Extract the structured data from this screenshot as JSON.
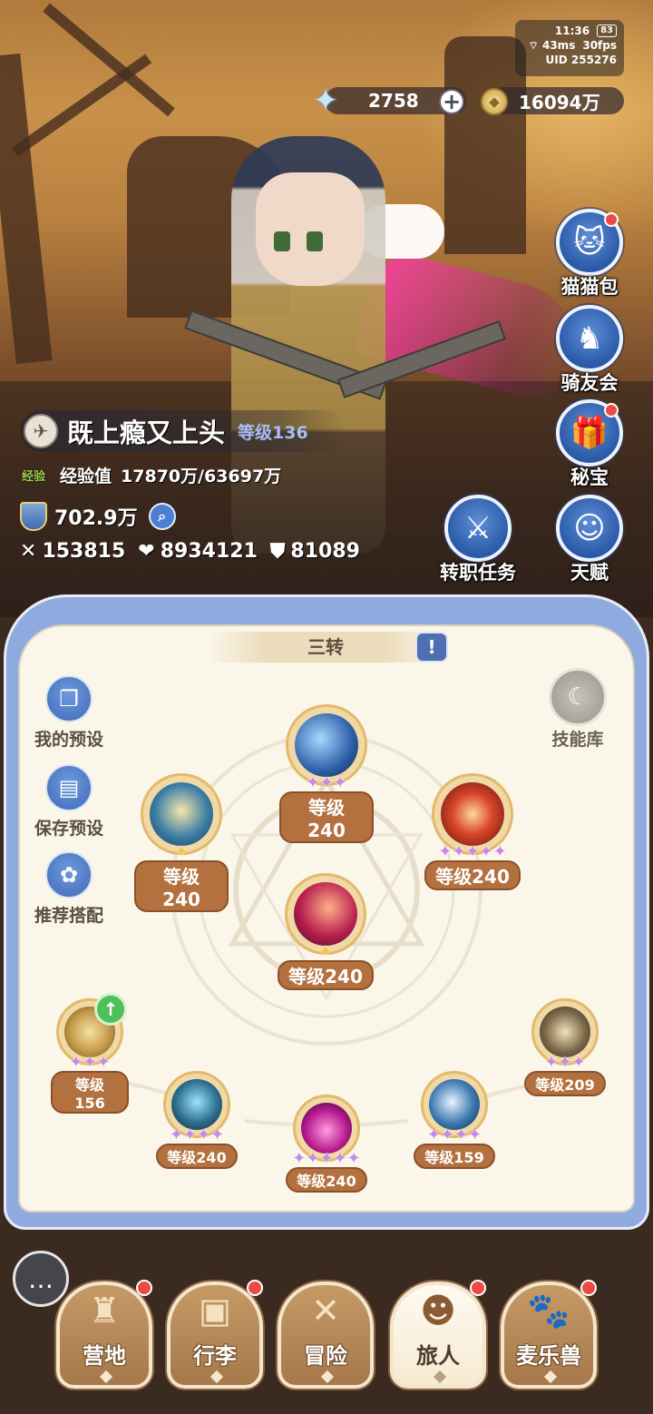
{
  "status": {
    "time": "11:36",
    "battery": "83",
    "ping": "43ms",
    "fps": "30fps",
    "uid": "UID 255276"
  },
  "currency": {
    "stars": "2758",
    "coins": "16094万"
  },
  "side_menu": [
    {
      "label": "猫猫包",
      "icon": "cat-bag-icon",
      "dot": true
    },
    {
      "label": "骑友会",
      "icon": "horse-icon",
      "dot": false
    },
    {
      "label": "秘宝",
      "icon": "treasure-icon",
      "dot": true
    },
    {
      "label": "转职任务",
      "icon": "class-quest-icon",
      "dot": false
    },
    {
      "label": "天赋",
      "icon": "talent-icon",
      "dot": false
    }
  ],
  "player": {
    "name": "既上瘾又上头",
    "level": "等级136",
    "exp_tag": "经验",
    "exp_label": "经验值",
    "exp_value": "17870万/63697万",
    "power": "702.9万",
    "attack": "153815",
    "hp": "8934121",
    "defense": "81089"
  },
  "panel": {
    "title": "三转",
    "book": "!",
    "left_buttons": [
      {
        "label": "我的预设",
        "icon": "preset-icon"
      },
      {
        "label": "保存预设",
        "icon": "save-icon"
      },
      {
        "label": "推荐搭配",
        "icon": "recommend-icon"
      }
    ],
    "skill_library": "技能库"
  },
  "skills": [
    {
      "id": "top",
      "level": "等级240",
      "purple": 3,
      "gold": 0,
      "color": "#2c5fa8"
    },
    {
      "id": "left",
      "level": "等级240",
      "purple": 0,
      "gold": 1,
      "color": "#3d7fa6"
    },
    {
      "id": "right",
      "level": "等级240",
      "purple": 5,
      "gold": 0,
      "color": "#b8321f"
    },
    {
      "id": "center",
      "level": "等级240",
      "purple": 0,
      "gold": 1,
      "color": "#a8204e"
    },
    {
      "id": "far-left",
      "level": "等级156",
      "purple": 3,
      "gold": 0,
      "color": "#c49a4a"
    },
    {
      "id": "bottom-1",
      "level": "等级240",
      "purple": 4,
      "gold": 0,
      "color": "#2e6f8f"
    },
    {
      "id": "bottom-2",
      "level": "等级240",
      "purple": 5,
      "gold": 0,
      "color": "#8e1a6e"
    },
    {
      "id": "bottom-3",
      "level": "等级159",
      "purple": 4,
      "gold": 0,
      "color": "#3a78b0"
    },
    {
      "id": "far-right",
      "level": "等级209",
      "purple": 3,
      "gold": 0,
      "color": "#7d6a4a"
    }
  ],
  "bottom_nav": [
    {
      "label": "营地",
      "icon": "castle-icon",
      "dot": true,
      "active": false
    },
    {
      "label": "行李",
      "icon": "backpack-icon",
      "dot": true,
      "active": false
    },
    {
      "label": "冒险",
      "icon": "crossed-swords-icon",
      "dot": false,
      "active": false
    },
    {
      "label": "旅人",
      "icon": "traveler-icon",
      "dot": true,
      "active": true
    },
    {
      "label": "麦乐兽",
      "icon": "pet-icon",
      "dot": true,
      "active": false
    }
  ]
}
